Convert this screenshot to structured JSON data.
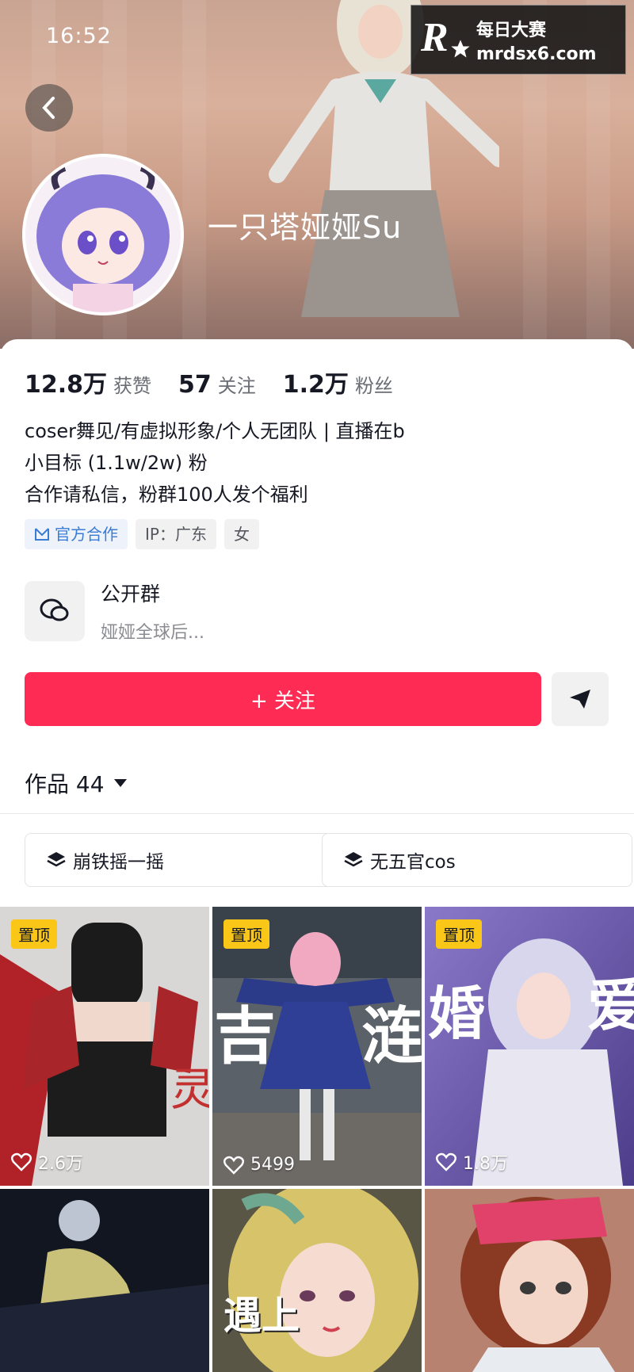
{
  "status_bar": {
    "time": "16:52"
  },
  "watermark": {
    "logo": "R",
    "cn": "每日大赛",
    "url": "mrdsx6.com"
  },
  "profile": {
    "nickname": "一只塔娅娅Su",
    "stats": [
      {
        "value": "12.8万",
        "label": "获赞"
      },
      {
        "value": "57",
        "label": "关注"
      },
      {
        "value": "1.2万",
        "label": "粉丝"
      }
    ],
    "bio_lines": [
      "coser舞见/有虚拟形象/个人无团队 | 直播在b",
      "小目标 (1.1w/2w) 粉",
      "合作请私信，粉群100人发个福利"
    ],
    "tags": {
      "official": "官方合作",
      "ip": "IP：广东",
      "gender": "女"
    }
  },
  "group": {
    "title": "公开群",
    "subtitle": "娅娅全球后..."
  },
  "actions": {
    "follow_label": "+ 关注"
  },
  "works": {
    "label": "作品 44"
  },
  "collections": [
    "崩铁摇一摇",
    "无五官cos"
  ],
  "videos": [
    {
      "pinned": "置顶",
      "likes": "2.6万",
      "colors": [
        "#d8d6d4",
        "#a8262a"
      ]
    },
    {
      "pinned": "置顶",
      "likes": "5499",
      "colors": [
        "#3a4a56",
        "#2c3a8a"
      ]
    },
    {
      "pinned": "置顶",
      "likes": "1.8万",
      "colors": [
        "#6b5aa8",
        "#b8b6dc"
      ]
    },
    {
      "pinned": "",
      "likes": "",
      "colors": [
        "#141822",
        "#2b3450"
      ]
    },
    {
      "pinned": "",
      "likes": "",
      "colors": [
        "#4c4a3a",
        "#d8c26a"
      ],
      "overlay": "遇上"
    },
    {
      "pinned": "",
      "likes": "",
      "colors": [
        "#8a5b52",
        "#d7a58f"
      ]
    }
  ],
  "colors": {
    "accent": "#fe2c55",
    "pin": "#fac719",
    "official": "#3a7bd5"
  }
}
